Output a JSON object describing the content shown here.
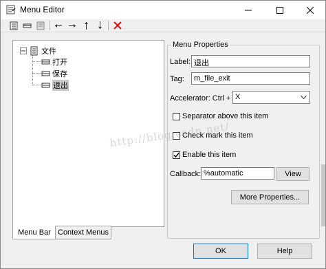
{
  "window": {
    "title": "Menu Editor"
  },
  "toolbar": {
    "buttons": [
      "new-menu-icon",
      "new-menu-item-icon",
      "new-context-menu-icon",
      "move-left-icon",
      "move-right-icon",
      "move-up-icon",
      "move-down-icon",
      "delete-icon"
    ]
  },
  "tree": {
    "root": "文件",
    "items": [
      "打开",
      "保存",
      "退出"
    ],
    "selected": "退出"
  },
  "tabs": {
    "menu_bar": "Menu Bar",
    "context_menus": "Context Menus"
  },
  "props": {
    "title": "Menu Properties",
    "label_caption": "Label:",
    "label_value": "退出",
    "tag_caption": "Tag:",
    "tag_value": "m_file_exit",
    "accel_caption": "Accelerator: Ctrl +",
    "accel_value": "X",
    "separator": "Separator above this item",
    "checkmark": "Check mark this item",
    "enable": "Enable this item",
    "callback_caption": "Callback:",
    "callback_value": "%automatic",
    "view": "View",
    "more": "More Properties..."
  },
  "footer": {
    "ok": "OK",
    "help": "Help"
  },
  "watermark": "http://blog.csdn.net/",
  "colors": {
    "selection": "#c8c8c8",
    "accent": "#0078d7",
    "delete": "#d11"
  }
}
